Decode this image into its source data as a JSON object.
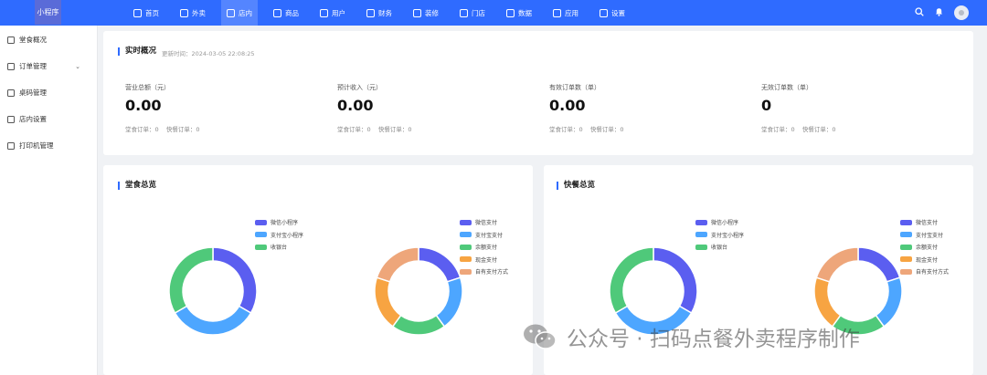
{
  "app": {
    "logo_text": "小程序"
  },
  "nav": [
    {
      "label": "首页",
      "icon": "home-icon"
    },
    {
      "label": "外卖",
      "icon": "takeout-icon"
    },
    {
      "label": "店内",
      "icon": "store-icon",
      "active": true
    },
    {
      "label": "商品",
      "icon": "goods-icon"
    },
    {
      "label": "用户",
      "icon": "user-icon"
    },
    {
      "label": "财务",
      "icon": "finance-icon"
    },
    {
      "label": "装修",
      "icon": "decoration-icon"
    },
    {
      "label": "门店",
      "icon": "shop-icon"
    },
    {
      "label": "数据",
      "icon": "data-icon"
    },
    {
      "label": "应用",
      "icon": "apps-icon"
    },
    {
      "label": "设置",
      "icon": "settings-icon"
    }
  ],
  "sidebar": {
    "items": [
      {
        "label": "堂食概况",
        "icon": "overview-icon"
      },
      {
        "label": "订单管理",
        "icon": "order-icon",
        "has_chevron": true
      },
      {
        "label": "桌码管理",
        "icon": "table-code-icon"
      },
      {
        "label": "店内设置",
        "icon": "store-settings-icon"
      },
      {
        "label": "打印机管理",
        "icon": "printer-icon"
      }
    ]
  },
  "realtime": {
    "title": "实时概况",
    "updated": "更新时间：2024-03-05 22:08:25",
    "stats": [
      {
        "label": "营业总额（元）",
        "value": "0.00",
        "sub": "堂食订单：0    快餐订单：0"
      },
      {
        "label": "预计收入（元）",
        "value": "0.00",
        "sub": "堂食订单：0    快餐订单：0"
      },
      {
        "label": "有效订单数（单）",
        "value": "0.00",
        "sub": "堂食订单：0    快餐订单：0"
      },
      {
        "label": "无效订单数（单）",
        "value": "0",
        "sub": "堂食订单：0    快餐订单：0"
      }
    ]
  },
  "dine_in": {
    "title": "堂食总览",
    "source_legend": [
      "微信小程序",
      "支付宝小程序",
      "收银台"
    ],
    "payment_legend": [
      "微信支付",
      "支付宝支付",
      "余额支付",
      "现金支付",
      "自有支付方式"
    ]
  },
  "fast_food": {
    "title": "快餐总览",
    "source_legend": [
      "微信小程序",
      "支付宝小程序",
      "收银台"
    ],
    "payment_legend": [
      "微信支付",
      "支付宝支付",
      "余额支付",
      "现金支付",
      "自有支付方式"
    ]
  },
  "colors": {
    "primary": "#2f6bff",
    "series": [
      "#5b5ef0",
      "#4da6ff",
      "#4fc97a",
      "#f7a442",
      "#eea67a"
    ]
  },
  "watermark": {
    "text": "公众号 · 扫码点餐外卖程序制作"
  }
}
